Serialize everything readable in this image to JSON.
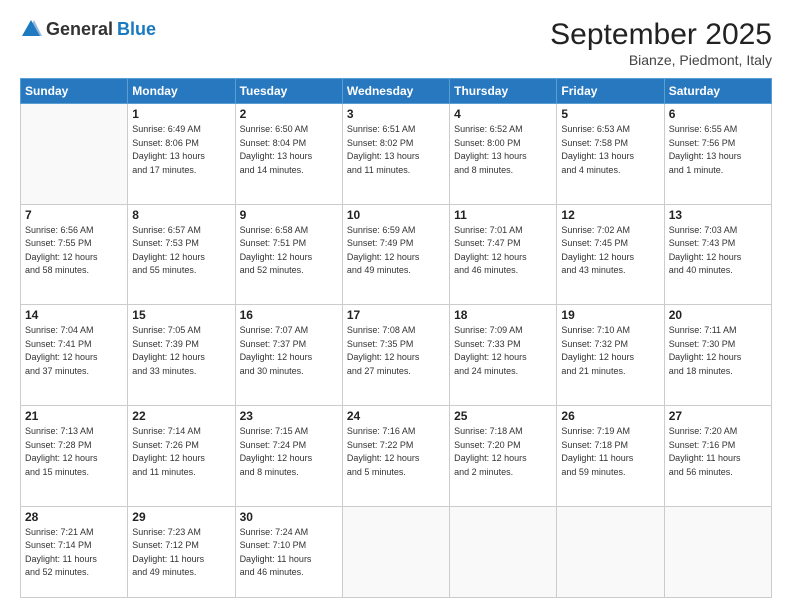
{
  "header": {
    "logo": {
      "general": "General",
      "blue": "Blue"
    },
    "title": "September 2025",
    "subtitle": "Bianze, Piedmont, Italy"
  },
  "weekdays": [
    "Sunday",
    "Monday",
    "Tuesday",
    "Wednesday",
    "Thursday",
    "Friday",
    "Saturday"
  ],
  "weeks": [
    [
      {
        "day": "",
        "info": ""
      },
      {
        "day": "1",
        "info": "Sunrise: 6:49 AM\nSunset: 8:06 PM\nDaylight: 13 hours\nand 17 minutes."
      },
      {
        "day": "2",
        "info": "Sunrise: 6:50 AM\nSunset: 8:04 PM\nDaylight: 13 hours\nand 14 minutes."
      },
      {
        "day": "3",
        "info": "Sunrise: 6:51 AM\nSunset: 8:02 PM\nDaylight: 13 hours\nand 11 minutes."
      },
      {
        "day": "4",
        "info": "Sunrise: 6:52 AM\nSunset: 8:00 PM\nDaylight: 13 hours\nand 8 minutes."
      },
      {
        "day": "5",
        "info": "Sunrise: 6:53 AM\nSunset: 7:58 PM\nDaylight: 13 hours\nand 4 minutes."
      },
      {
        "day": "6",
        "info": "Sunrise: 6:55 AM\nSunset: 7:56 PM\nDaylight: 13 hours\nand 1 minute."
      }
    ],
    [
      {
        "day": "7",
        "info": "Sunrise: 6:56 AM\nSunset: 7:55 PM\nDaylight: 12 hours\nand 58 minutes."
      },
      {
        "day": "8",
        "info": "Sunrise: 6:57 AM\nSunset: 7:53 PM\nDaylight: 12 hours\nand 55 minutes."
      },
      {
        "day": "9",
        "info": "Sunrise: 6:58 AM\nSunset: 7:51 PM\nDaylight: 12 hours\nand 52 minutes."
      },
      {
        "day": "10",
        "info": "Sunrise: 6:59 AM\nSunset: 7:49 PM\nDaylight: 12 hours\nand 49 minutes."
      },
      {
        "day": "11",
        "info": "Sunrise: 7:01 AM\nSunset: 7:47 PM\nDaylight: 12 hours\nand 46 minutes."
      },
      {
        "day": "12",
        "info": "Sunrise: 7:02 AM\nSunset: 7:45 PM\nDaylight: 12 hours\nand 43 minutes."
      },
      {
        "day": "13",
        "info": "Sunrise: 7:03 AM\nSunset: 7:43 PM\nDaylight: 12 hours\nand 40 minutes."
      }
    ],
    [
      {
        "day": "14",
        "info": "Sunrise: 7:04 AM\nSunset: 7:41 PM\nDaylight: 12 hours\nand 37 minutes."
      },
      {
        "day": "15",
        "info": "Sunrise: 7:05 AM\nSunset: 7:39 PM\nDaylight: 12 hours\nand 33 minutes."
      },
      {
        "day": "16",
        "info": "Sunrise: 7:07 AM\nSunset: 7:37 PM\nDaylight: 12 hours\nand 30 minutes."
      },
      {
        "day": "17",
        "info": "Sunrise: 7:08 AM\nSunset: 7:35 PM\nDaylight: 12 hours\nand 27 minutes."
      },
      {
        "day": "18",
        "info": "Sunrise: 7:09 AM\nSunset: 7:33 PM\nDaylight: 12 hours\nand 24 minutes."
      },
      {
        "day": "19",
        "info": "Sunrise: 7:10 AM\nSunset: 7:32 PM\nDaylight: 12 hours\nand 21 minutes."
      },
      {
        "day": "20",
        "info": "Sunrise: 7:11 AM\nSunset: 7:30 PM\nDaylight: 12 hours\nand 18 minutes."
      }
    ],
    [
      {
        "day": "21",
        "info": "Sunrise: 7:13 AM\nSunset: 7:28 PM\nDaylight: 12 hours\nand 15 minutes."
      },
      {
        "day": "22",
        "info": "Sunrise: 7:14 AM\nSunset: 7:26 PM\nDaylight: 12 hours\nand 11 minutes."
      },
      {
        "day": "23",
        "info": "Sunrise: 7:15 AM\nSunset: 7:24 PM\nDaylight: 12 hours\nand 8 minutes."
      },
      {
        "day": "24",
        "info": "Sunrise: 7:16 AM\nSunset: 7:22 PM\nDaylight: 12 hours\nand 5 minutes."
      },
      {
        "day": "25",
        "info": "Sunrise: 7:18 AM\nSunset: 7:20 PM\nDaylight: 12 hours\nand 2 minutes."
      },
      {
        "day": "26",
        "info": "Sunrise: 7:19 AM\nSunset: 7:18 PM\nDaylight: 11 hours\nand 59 minutes."
      },
      {
        "day": "27",
        "info": "Sunrise: 7:20 AM\nSunset: 7:16 PM\nDaylight: 11 hours\nand 56 minutes."
      }
    ],
    [
      {
        "day": "28",
        "info": "Sunrise: 7:21 AM\nSunset: 7:14 PM\nDaylight: 11 hours\nand 52 minutes."
      },
      {
        "day": "29",
        "info": "Sunrise: 7:23 AM\nSunset: 7:12 PM\nDaylight: 11 hours\nand 49 minutes."
      },
      {
        "day": "30",
        "info": "Sunrise: 7:24 AM\nSunset: 7:10 PM\nDaylight: 11 hours\nand 46 minutes."
      },
      {
        "day": "",
        "info": ""
      },
      {
        "day": "",
        "info": ""
      },
      {
        "day": "",
        "info": ""
      },
      {
        "day": "",
        "info": ""
      }
    ]
  ]
}
